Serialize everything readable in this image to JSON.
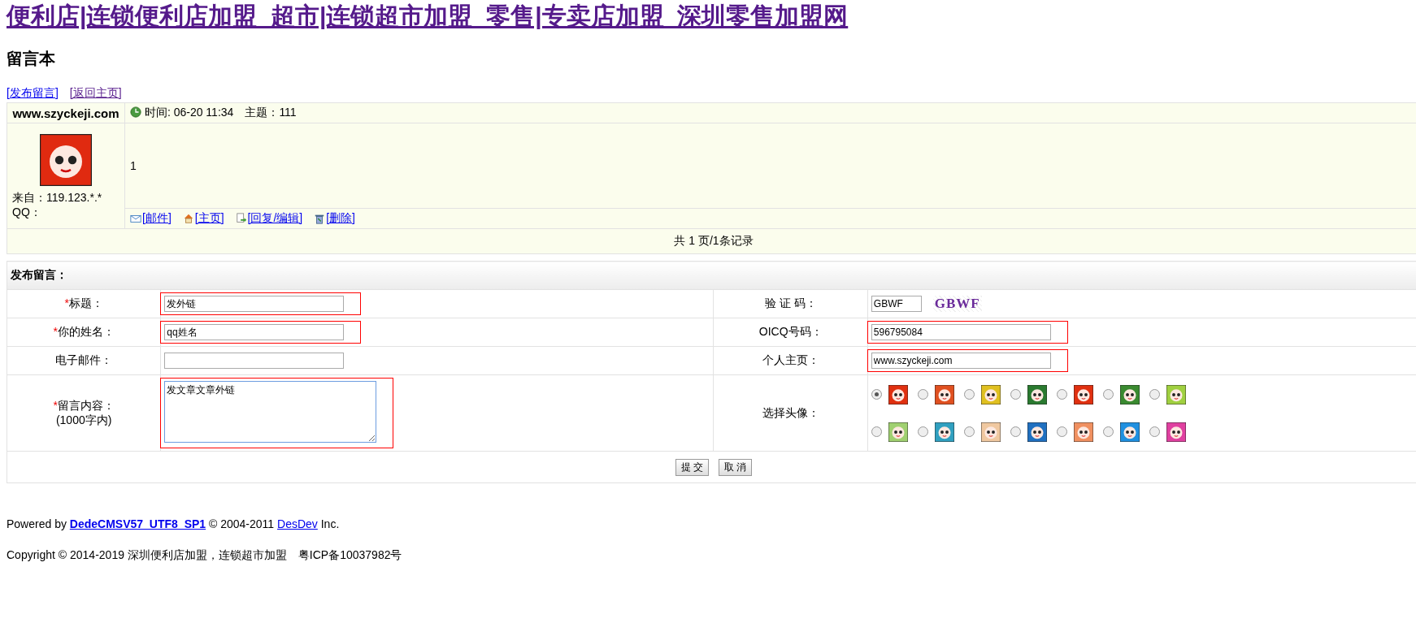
{
  "site_title": "便利店|连锁便利店加盟_超市|连锁超市加盟_零售|专卖店加盟_深圳零售加盟网",
  "page_title": "留言本",
  "top_links": [
    {
      "label": "[发布留言]",
      "visited": false
    },
    {
      "label": "[返回主页]",
      "visited": true
    }
  ],
  "post": {
    "author": "www.szyckeji.com",
    "time": "时间: 06-20 11:34",
    "subject": "主题：111",
    "from": "来自：119.123.*.*",
    "qq": "QQ：",
    "body": "1",
    "actions": [
      {
        "kind": "mail",
        "label": "[邮件]"
      },
      {
        "kind": "home",
        "label": "[主页]"
      },
      {
        "kind": "reply",
        "label": "[回复/编辑]"
      },
      {
        "kind": "delete",
        "label": "[删除]"
      }
    ]
  },
  "pager": "共 1 页/1条记录",
  "form": {
    "title": "发布留言：",
    "required_mark": "*",
    "rows": [
      {
        "left": {
          "label": "标题：",
          "required": true,
          "kind": "input",
          "value": "发外链",
          "highlighted": true
        },
        "right": {
          "label": "验 证 码：",
          "kind": "captcha",
          "value": "GBWF",
          "captcha": "GBWF"
        }
      },
      {
        "left": {
          "label": "你的姓名：",
          "required": true,
          "kind": "input",
          "value": "qq姓名",
          "highlighted": true
        },
        "right": {
          "label": "OICQ号码：",
          "kind": "input",
          "value": "596795084",
          "highlighted": true
        }
      },
      {
        "left": {
          "label": "电子邮件：",
          "required": false,
          "kind": "input"
        },
        "right": {
          "label": "个人主页：",
          "kind": "input",
          "value": "www.szyckeji.com",
          "highlighted": true
        }
      },
      {
        "left": {
          "label": "留言内容：",
          "note": "(1000字内)",
          "required": true,
          "kind": "textarea",
          "value": "发文章文章外链",
          "highlighted": true
        },
        "right": {
          "label": "选择头像：",
          "kind": "avatars",
          "avatars": [
            {
              "selected": true,
              "color": "#e03010"
            },
            {
              "selected": false,
              "color": "#e05020"
            },
            {
              "selected": false,
              "color": "#e0c020"
            },
            {
              "selected": false,
              "color": "#2a7a30"
            },
            {
              "selected": false,
              "color": "#e03010"
            },
            {
              "selected": false,
              "color": "#3a8a30"
            },
            {
              "selected": false,
              "color": "#a0d040"
            },
            {
              "selected": false,
              "color": "#a0d070"
            },
            {
              "selected": false,
              "color": "#30a0c0"
            },
            {
              "selected": false,
              "color": "#f0c8a0"
            },
            {
              "selected": false,
              "color": "#2070c0"
            },
            {
              "selected": false,
              "color": "#f09060"
            },
            {
              "selected": false,
              "color": "#2090e0"
            },
            {
              "selected": false,
              "color": "#e040a0"
            }
          ]
        }
      }
    ],
    "buttons": [
      "提 交",
      "取 消"
    ]
  },
  "footer": {
    "powered_prefix": "Powered by",
    "cms_link": "DedeCMSV57_UTF8_SP1",
    "copyright_years": "© 2004-2011",
    "company_link": "DesDev",
    "company_suffix": "Inc.",
    "copyright": "Copyright © 2014-2019 深圳便利店加盟，连锁超市加盟　粤ICP备10037982号"
  }
}
